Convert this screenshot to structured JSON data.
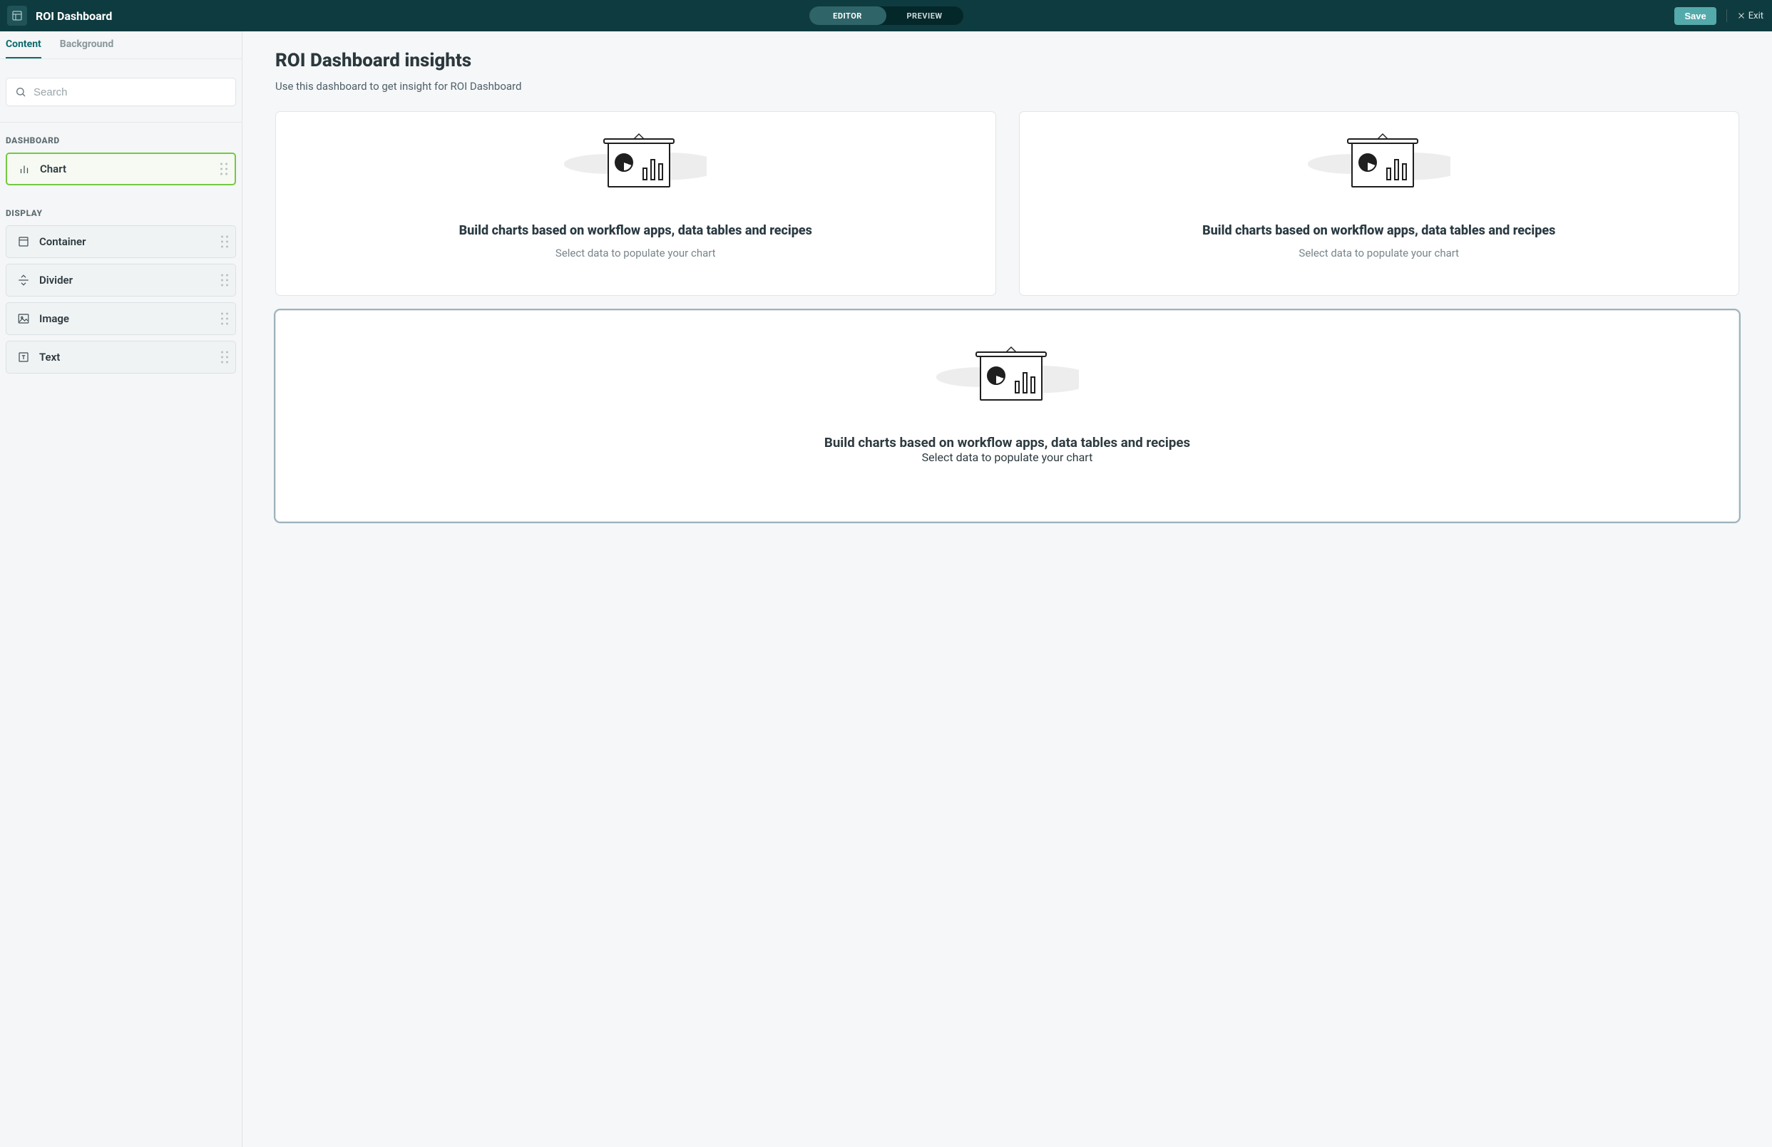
{
  "header": {
    "app_title": "ROI Dashboard",
    "tabs": {
      "editor": "EDITOR",
      "preview": "PREVIEW"
    },
    "save": "Save",
    "exit": "Exit"
  },
  "sidebar": {
    "tabs": {
      "content": "Content",
      "background": "Background"
    },
    "search_placeholder": "Search",
    "sections": {
      "dashboard": "DASHBOARD",
      "display": "DISPLAY"
    },
    "blocks": {
      "chart": "Chart",
      "container": "Container",
      "divider": "Divider",
      "image": "Image",
      "text": "Text"
    }
  },
  "main": {
    "title": "ROI Dashboard insights",
    "subtitle": "Use this dashboard to get insight for ROI Dashboard",
    "card_title": "Build charts based on workflow apps, data tables and recipes",
    "card_subtitle": "Select data to populate your chart"
  }
}
